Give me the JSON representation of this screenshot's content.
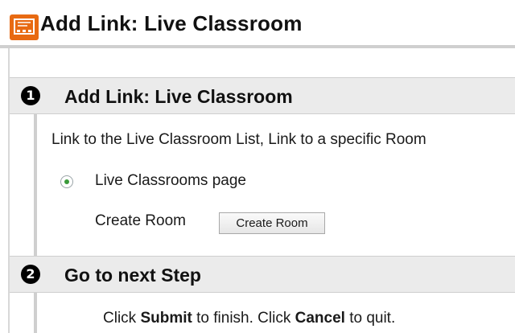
{
  "page": {
    "title": "Add Link: Live Classroom",
    "icon": "live-classroom-icon"
  },
  "steps": [
    {
      "number": "1",
      "title": "Add Link: Live Classroom",
      "description": "Link to the Live Classroom List, Link to a specific Room",
      "radio_label": "Live Classrooms page",
      "radio_selected": true,
      "create_room_label": "Create Room",
      "create_room_button": "Create Room"
    },
    {
      "number": "2",
      "title": "Go to next Step",
      "instruction": {
        "part1": "Click ",
        "submit": "Submit",
        "part2": " to finish. Click ",
        "cancel": "Cancel",
        "part3": " to quit."
      }
    }
  ],
  "colors": {
    "icon_orange": "#e86a12",
    "header_bg": "#ebebeb",
    "radio_dot": "#3a9a3a"
  }
}
